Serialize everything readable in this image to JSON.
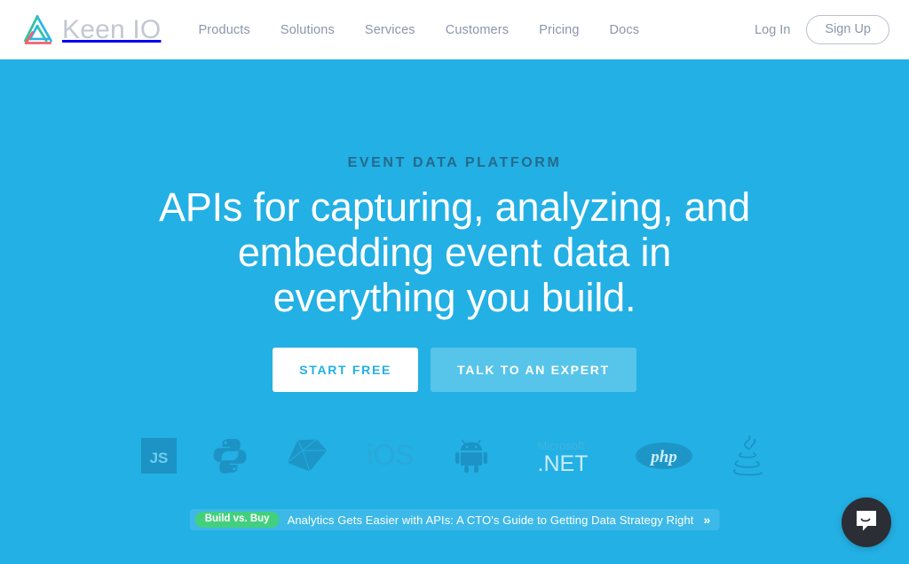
{
  "header": {
    "logo_icon": "keen-triangle-logo-icon",
    "wordmark": "Keen IO",
    "nav": [
      {
        "label": "Products"
      },
      {
        "label": "Solutions"
      },
      {
        "label": "Services"
      },
      {
        "label": "Customers"
      },
      {
        "label": "Pricing"
      },
      {
        "label": "Docs"
      }
    ],
    "login_label": "Log In",
    "signup_label": "Sign Up"
  },
  "hero": {
    "eyebrow": "EVENT DATA PLATFORM",
    "headline": "APIs for capturing, analyzing, and embedding event data in everything you build.",
    "primary_cta": "START FREE",
    "secondary_cta": "TALK TO AN EXPERT",
    "background_color": "#23b0e4"
  },
  "tech_logos": [
    {
      "name": "javascript-icon",
      "label": "JS"
    },
    {
      "name": "python-icon",
      "label": "Python"
    },
    {
      "name": "ruby-icon",
      "label": "Ruby"
    },
    {
      "name": "ios-icon",
      "label": "iOS"
    },
    {
      "name": "android-icon",
      "label": "Android"
    },
    {
      "name": "dotnet-icon",
      "label": "Microsoft .NET",
      "line1": "Microsoft",
      "line2": ".NET"
    },
    {
      "name": "php-icon",
      "label": "php"
    },
    {
      "name": "java-icon",
      "label": "Java"
    }
  ],
  "banner": {
    "badge": "Build vs. Buy",
    "badge_color": "#43d07e",
    "text": "Analytics Gets Easier with APIs: A CTO's Guide to Getting Data Strategy Right",
    "arrow": "»"
  },
  "chat": {
    "launcher_icon": "chat-bubble-smile-icon",
    "launcher_color": "#2b2e34"
  }
}
